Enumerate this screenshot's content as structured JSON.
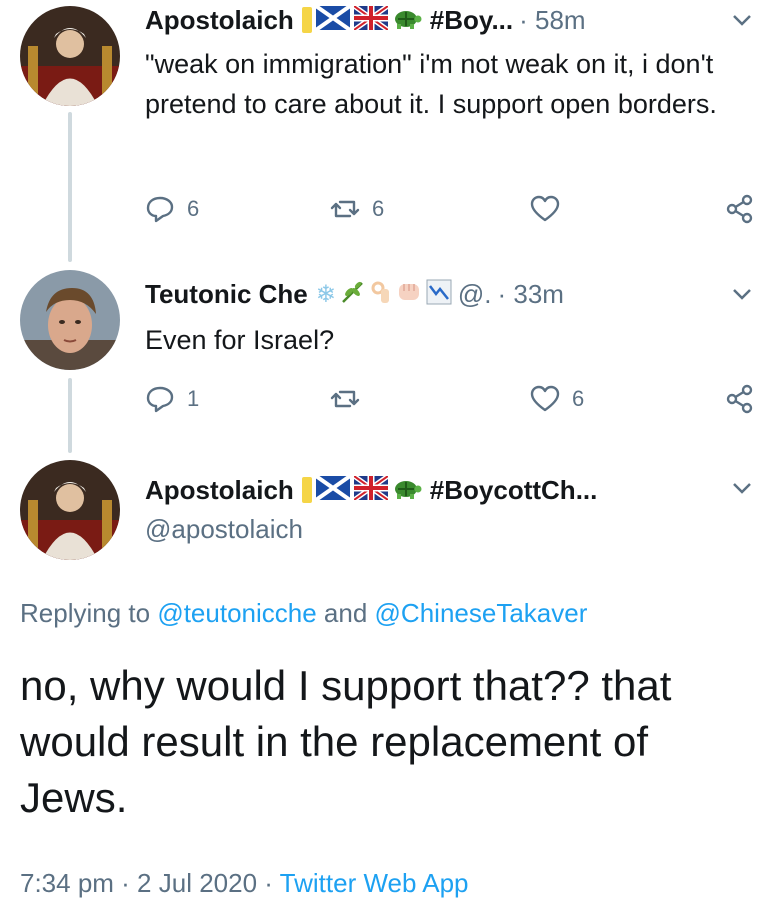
{
  "tweets": [
    {
      "name": "Apostolaich",
      "tag": "#Boy...",
      "time": "· 58m",
      "text": "\"weak on immigration\" i'm not weak on it, i don't pretend to care about it. I support open borders.",
      "replies": "6",
      "retweets": "6",
      "likes": ""
    },
    {
      "name": "Teutonic Che",
      "handle_short": "@.",
      "time": "· 33m",
      "text": "Even for Israel?",
      "replies": "1",
      "retweets": "",
      "likes": "6"
    },
    {
      "name": "Apostolaich",
      "tag": "#BoycottCh...",
      "handle": "@apostolaich",
      "replying_prefix": "Replying to ",
      "mention_1": "@teutonicche",
      "replying_and": " and ",
      "mention_2": "@ChineseTakaver",
      "text": "no, why would I support that?? that would result in the replacement of Jews.",
      "timestamp": "7:34 pm · 2 Jul 2020 · ",
      "app": "Twitter Web App"
    }
  ],
  "icons": [
    "reply-icon",
    "retweet-icon",
    "like-icon",
    "share-icon",
    "chevron-down-icon"
  ],
  "colors": {
    "text": "#14171a",
    "muted": "#5b7083",
    "link": "#1da1f2",
    "thread_line": "#cfd9de"
  }
}
